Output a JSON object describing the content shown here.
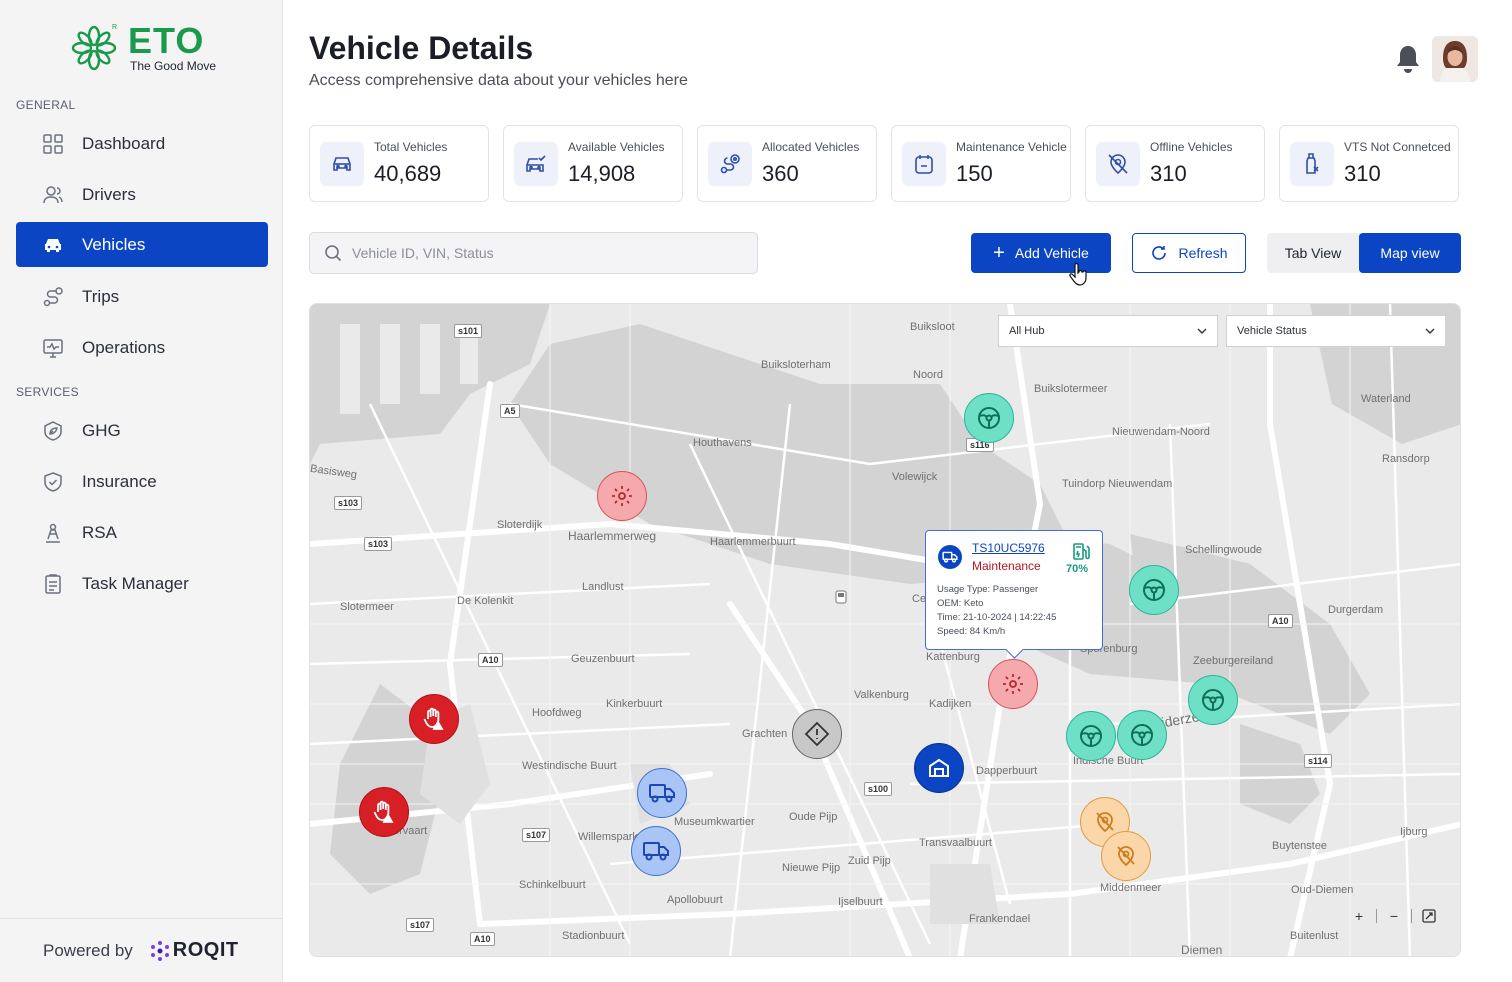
{
  "brand": {
    "name": "ETO",
    "tagline": "The Good Move",
    "reg": "R",
    "colors": {
      "green": "#1a9a4a",
      "primary": "#0b45c4"
    }
  },
  "sidebar": {
    "general_label": "GENERAL",
    "services_label": "SERVICES",
    "general_items": [
      {
        "label": "Dashboard",
        "icon": "dashboard-icon"
      },
      {
        "label": "Drivers",
        "icon": "drivers-icon"
      },
      {
        "label": "Vehicles",
        "icon": "car-icon",
        "active": true
      },
      {
        "label": "Trips",
        "icon": "route-icon"
      },
      {
        "label": "Operations",
        "icon": "monitor-icon"
      }
    ],
    "service_items": [
      {
        "label": "GHG",
        "icon": "leaf-icon"
      },
      {
        "label": "Insurance",
        "icon": "shield-icon"
      },
      {
        "label": "RSA",
        "icon": "rsa-icon"
      },
      {
        "label": "Task Manager",
        "icon": "clipboard-icon"
      }
    ],
    "powered_by": "Powered by",
    "partner": "ROQIT"
  },
  "header": {
    "title": "Vehicle Details",
    "subtitle": "Access comprehensive data about your vehicles here"
  },
  "stats": [
    {
      "label": "Total Vehicles",
      "value": "40,689",
      "icon": "car-icon"
    },
    {
      "label": "Available Vehicles",
      "value": "14,908",
      "icon": "car-check-icon"
    },
    {
      "label": "Allocated Vehicles",
      "value": "360",
      "icon": "route-icon"
    },
    {
      "label": "Maintenance Vehicle",
      "value": "150",
      "icon": "calendar-icon"
    },
    {
      "label": "Offline Vehicles",
      "value": "310",
      "icon": "offline-location-icon"
    },
    {
      "label": "VTS Not Connetced",
      "value": "310",
      "icon": "vts-disconnected-icon"
    }
  ],
  "toolbar": {
    "search_placeholder": "Vehicle ID, VIN, Status",
    "add_label": "Add Vehicle",
    "refresh_label": "Refresh",
    "tab_view": "Tab View",
    "map_view": "Map view"
  },
  "map": {
    "hub_select": "All Hub",
    "status_select": "Vehicle Status",
    "labels": [
      "Buiksloot",
      "Buiksloterham",
      "Noord",
      "Buikslotermeer",
      "Waterland",
      "Nieuwendam-Noord",
      "Ransdorp",
      "Houthavens",
      "Volewijck",
      "Tuindorp Nieuwendam",
      "Basisweg",
      "Sloterdijk",
      "Haarlemmerweg",
      "Haarlemmerbuurt",
      "Schellingwoude",
      "Landlust",
      "Slotermeer",
      "De Kolenkit",
      "Durgerdam",
      "Geuzenbuurt",
      "Kattenburg",
      "Sporenburg",
      "Zeeburgereiland",
      "Kinkerbuurt",
      "Hoofdweg",
      "Grachten",
      "Valkenburg",
      "Kadijken",
      "Zuiderzee",
      "Westindische Buurt",
      "Dapperbuurt",
      "Indische Buurt",
      "Museumkwartier",
      "Oude Pijp",
      "Willemspark",
      "Nieuwe Pijp",
      "Zuid Pijp",
      "Transvaalbuurt",
      "Buytenstee",
      "Ijburg",
      "Schinkelbuurt",
      "Apollobuurt",
      "Ijselbuurt",
      "Middenmeer",
      "Oud-Diemen",
      "Stadionbuurt",
      "Frankendael",
      "Diemen",
      "Buitenlust",
      "Slotervaart",
      "Ce"
    ],
    "road_tags": [
      "s101",
      "A5",
      "s103",
      "s103",
      "A10",
      "s116",
      "A10",
      "s114",
      "s100",
      "s107",
      "s107",
      "A10"
    ],
    "popup": {
      "vehicle_id": "TS10UC5976",
      "status": "Maintenance",
      "fuel": "70%",
      "usage": "Usage Type: Passenger",
      "oem": "OEM: Keto",
      "time": "Time: 21-10-2024 | 14:22:45",
      "speed": "Speed: 84 Km/h"
    },
    "zoom": {
      "in": "+",
      "out": "−"
    }
  }
}
